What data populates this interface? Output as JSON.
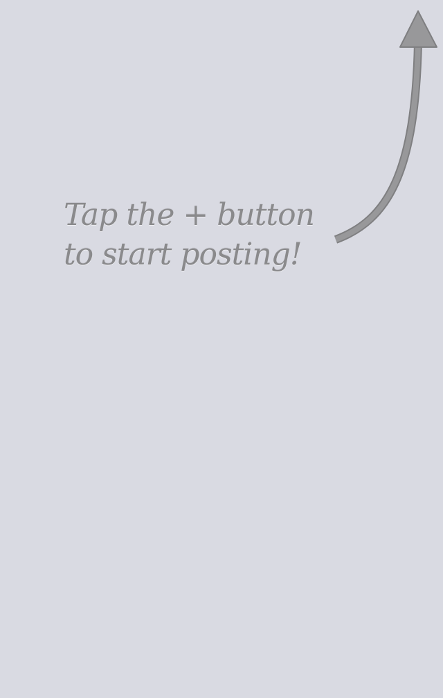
{
  "empty_state": {
    "hint_line_1": "Tap the + button",
    "hint_line_2": "to start posting!",
    "arrow_icon": "curved-arrow-up-icon"
  },
  "colors": {
    "background": "#d9dae2",
    "hint_text": "#8a8a8c",
    "arrow": "#959597"
  }
}
